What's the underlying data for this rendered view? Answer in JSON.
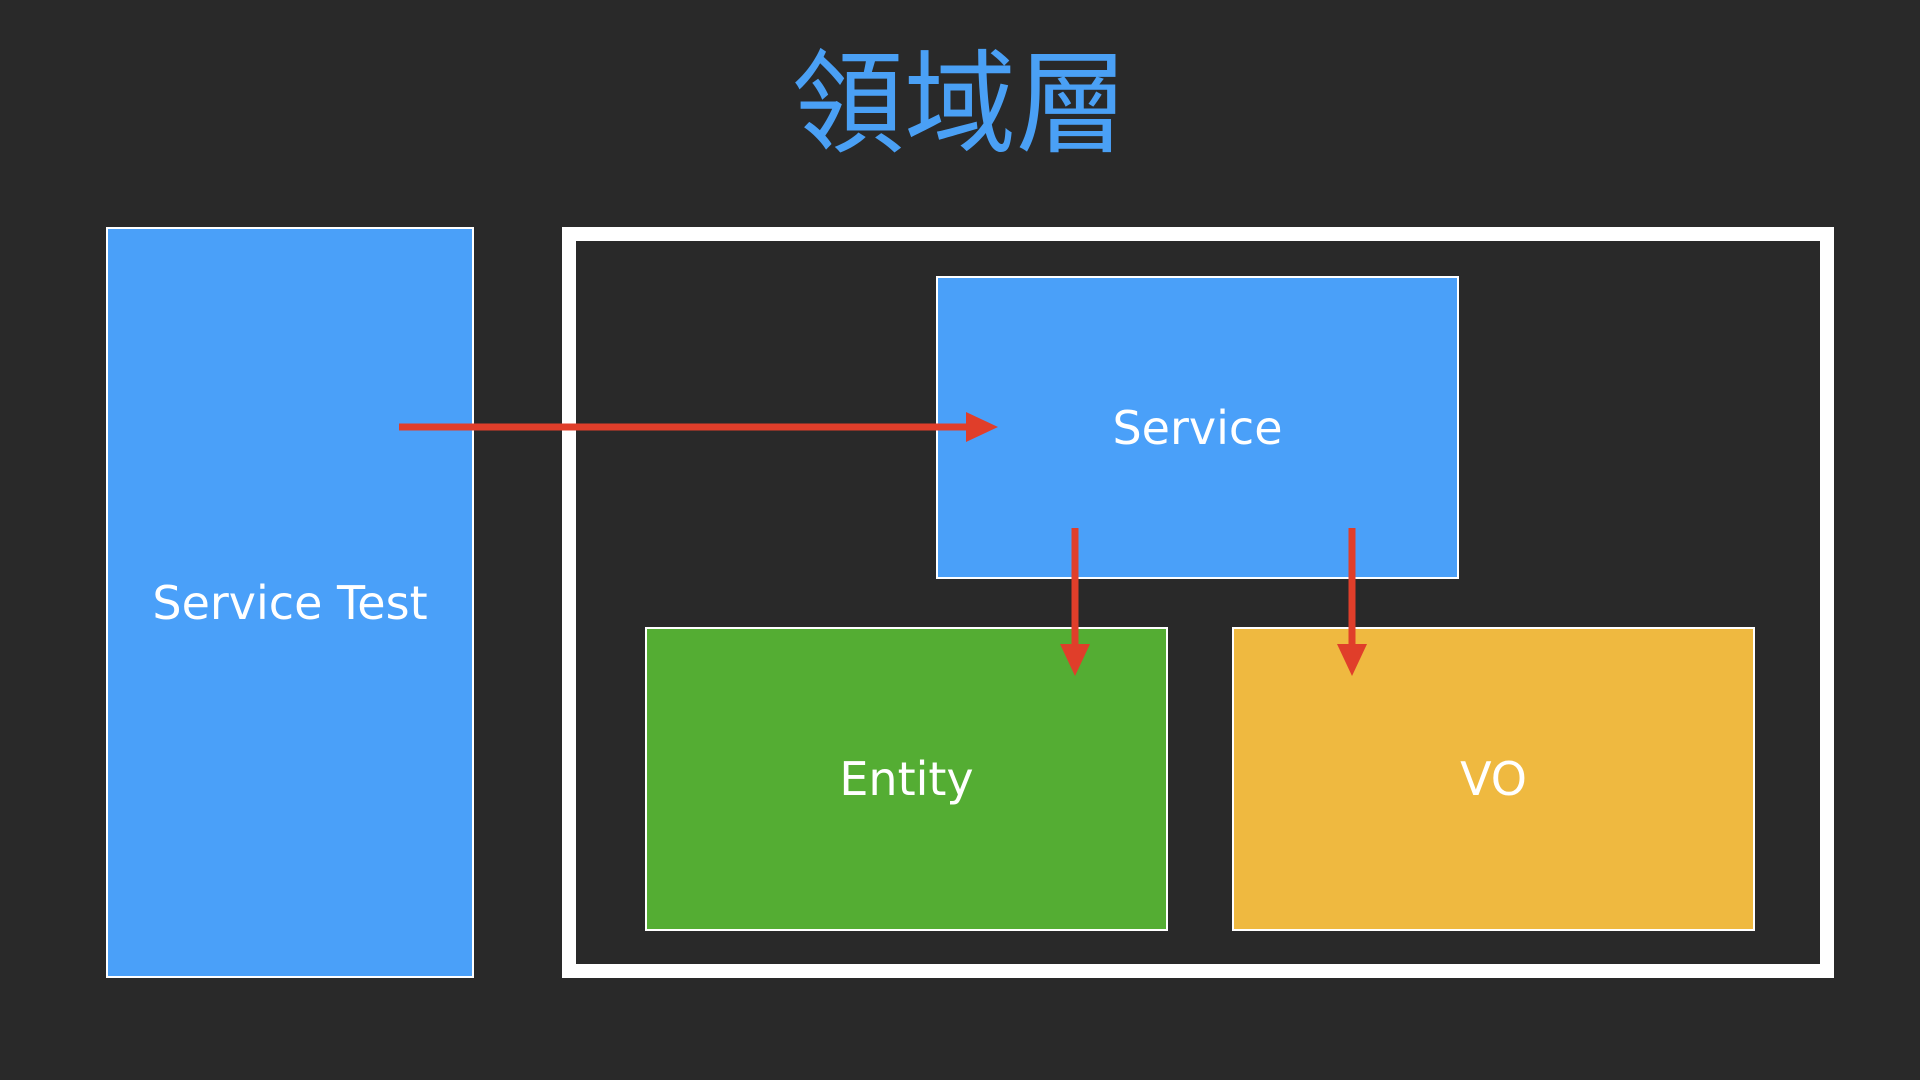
{
  "title": "領域層",
  "boxes": {
    "service_test": "Service Test",
    "service": "Service",
    "entity": "Entity",
    "vo": "VO"
  },
  "colors": {
    "background": "#292929",
    "title": "#4aa0f5",
    "service_blue": "#4aa0f9",
    "entity_green": "#54ad33",
    "vo_yellow": "#efb940",
    "arrow_red": "#e03e2a",
    "frame_white": "#ffffff"
  }
}
